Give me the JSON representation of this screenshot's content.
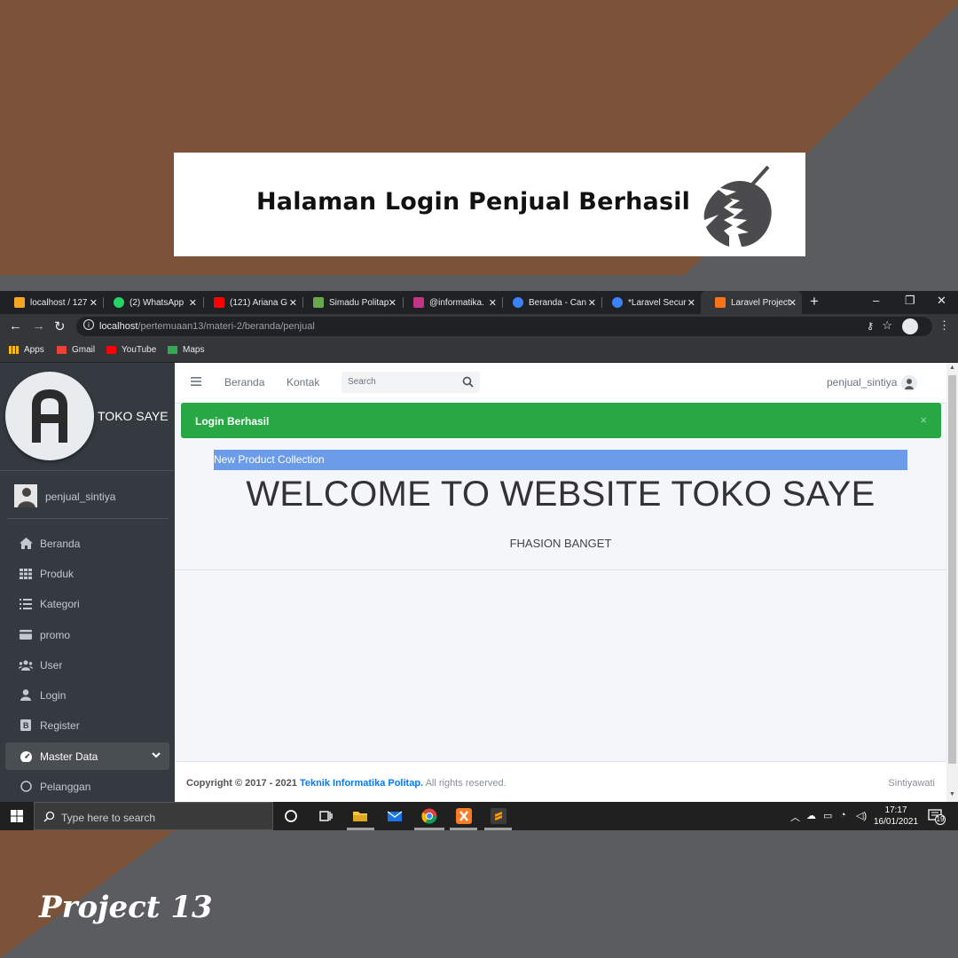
{
  "poster": {
    "title": "Halaman Login Penjual Berhasil",
    "footer_label": "Project 13"
  },
  "browser": {
    "tabs": [
      {
        "label": "localhost / 127",
        "color": "#f5a623"
      },
      {
        "label": "(2) WhatsApp",
        "color": "#25d366"
      },
      {
        "label": "(121) Ariana G",
        "color": "#ff0000"
      },
      {
        "label": "Simadu Politap",
        "color": "#6aa84f"
      },
      {
        "label": "@informatika.",
        "color": "#c13584"
      },
      {
        "label": "Beranda - Can",
        "color": "#3b82f6"
      },
      {
        "label": "*Laravel Secur",
        "color": "#3b82f6"
      },
      {
        "label": "Laravel Project",
        "color": "#f97316"
      }
    ],
    "active_tab_index": 7,
    "url_host": "localhost",
    "url_path": "/pertemuaan13/materi-2/beranda/penjual",
    "bookmarks": [
      {
        "label": "Apps",
        "color": "#fbbc05"
      },
      {
        "label": "Gmail",
        "color": "#ea4335"
      },
      {
        "label": "YouTube",
        "color": "#ff0000"
      },
      {
        "label": "Maps",
        "color": "#34a853"
      }
    ]
  },
  "sidebar": {
    "brand_name": "TOKO SAYE",
    "user_name": "penjual_sintiya",
    "items": [
      {
        "label": "Beranda",
        "icon": "home-icon"
      },
      {
        "label": "Produk",
        "icon": "grid-icon"
      },
      {
        "label": "Kategori",
        "icon": "list-icon"
      },
      {
        "label": "promo",
        "icon": "card-icon"
      },
      {
        "label": "User",
        "icon": "users-icon"
      },
      {
        "label": "Login",
        "icon": "user-icon"
      },
      {
        "label": "Register",
        "icon": "register-icon"
      },
      {
        "label": "Master Data",
        "icon": "dashboard-icon"
      },
      {
        "label": "Pelanggan",
        "icon": "circle-icon"
      }
    ]
  },
  "topnav": {
    "links": [
      "Beranda",
      "Kontak"
    ],
    "search_placeholder": "Search",
    "user": "penjual_sintiya"
  },
  "alert": {
    "text": "Login Berhasil",
    "close": "×",
    "color": "#28a745"
  },
  "hero": {
    "strip": "New Product Collection",
    "title": "WELCOME TO WEBSITE TOKO SAYE",
    "subtitle": "FHASION BANGET"
  },
  "footer": {
    "copyright": "Copyright © 2017 - 2021",
    "org": "Teknik Informatika Politap.",
    "rights": "All rights reserved.",
    "author": "Sintiyawati"
  },
  "taskbar": {
    "search_placeholder": "Type here to search",
    "time": "17:17",
    "date": "16/01/2021",
    "notifications": "19"
  }
}
